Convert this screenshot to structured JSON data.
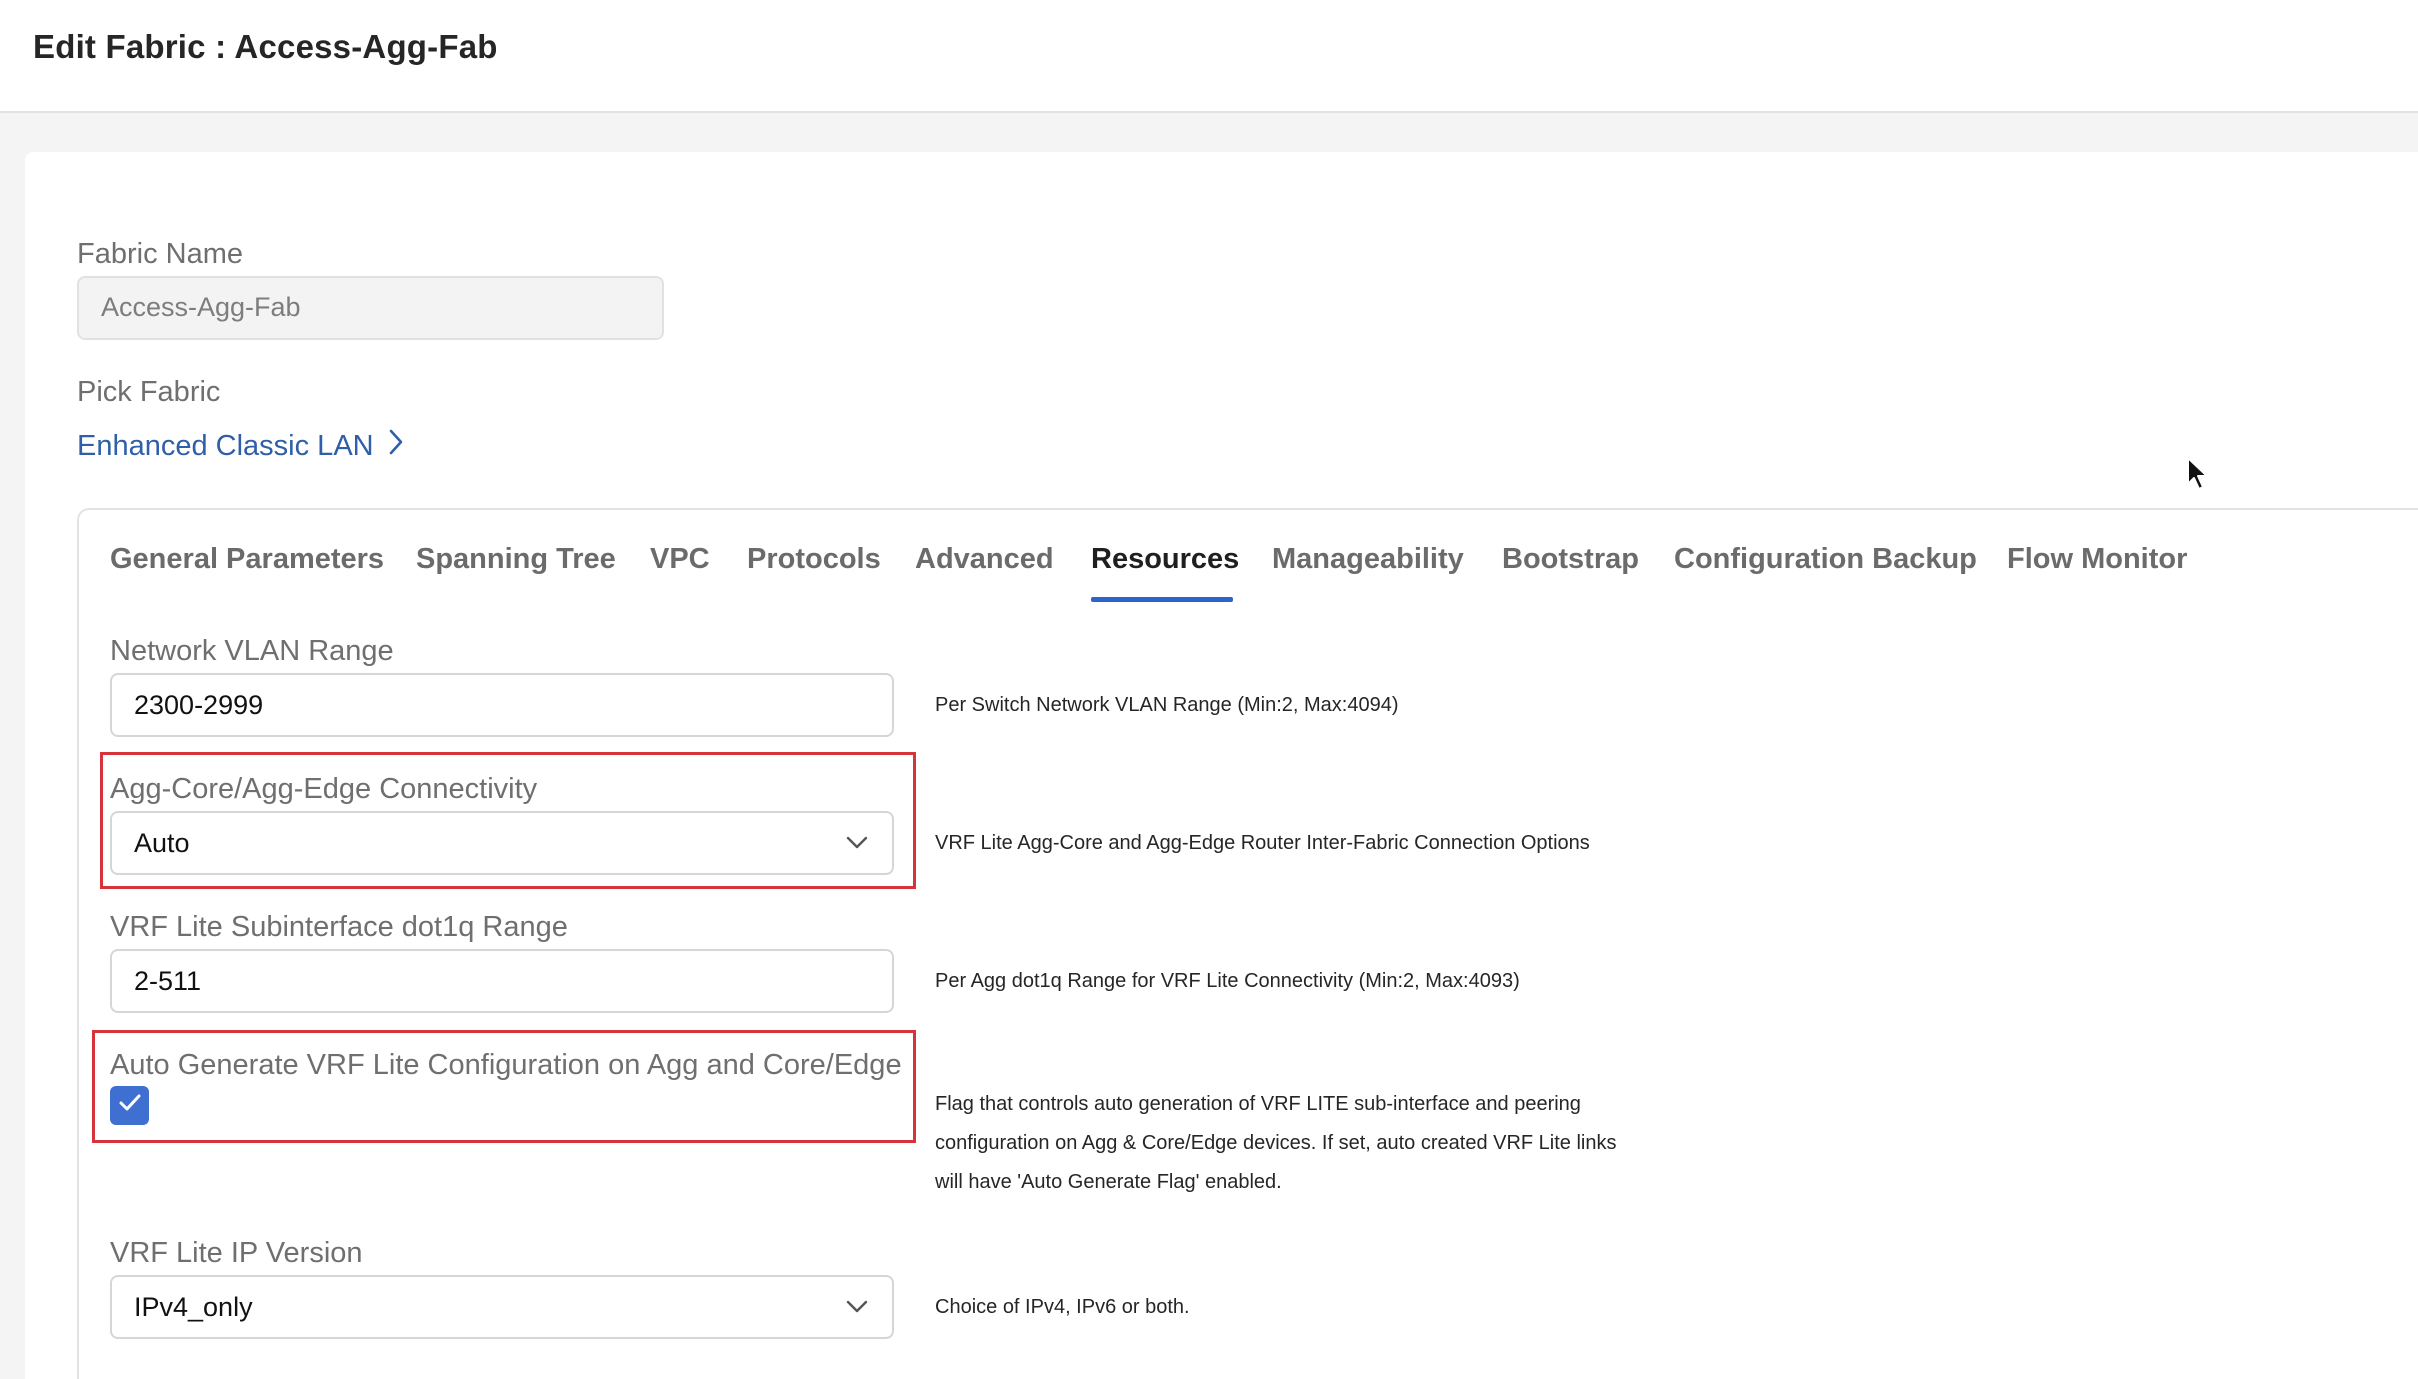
{
  "header": {
    "title": "Edit Fabric : Access-Agg-Fab"
  },
  "fabric_name": {
    "label": "Fabric Name",
    "value": "Access-Agg-Fab"
  },
  "pick_fabric": {
    "label": "Pick Fabric",
    "link": "Enhanced Classic LAN"
  },
  "tabs": [
    {
      "label": "General Parameters"
    },
    {
      "label": "Spanning Tree"
    },
    {
      "label": "VPC"
    },
    {
      "label": "Protocols"
    },
    {
      "label": "Advanced"
    },
    {
      "label": "Resources",
      "active": true
    },
    {
      "label": "Manageability"
    },
    {
      "label": "Bootstrap"
    },
    {
      "label": "Configuration Backup"
    },
    {
      "label": "Flow Monitor"
    }
  ],
  "fields": {
    "network_vlan": {
      "label": "Network VLAN Range",
      "value": "2300-2999",
      "help": "Per Switch Network VLAN Range (Min:2, Max:4094)"
    },
    "agg_connectivity": {
      "label": "Agg-Core/Agg-Edge Connectivity",
      "value": "Auto",
      "help": "VRF Lite Agg-Core and Agg-Edge Router Inter-Fabric Connection Options"
    },
    "dot1q_range": {
      "label": "VRF Lite Subinterface dot1q Range",
      "value": "2-511",
      "help": "Per Agg dot1q Range for VRF Lite Connectivity (Min:2, Max:4093)"
    },
    "auto_generate": {
      "label": "Auto Generate VRF Lite Configuration on Agg and Core/Edge",
      "checked": true,
      "help_lines": [
        "Flag that controls auto generation of VRF LITE sub-interface and peering",
        "configuration on Agg & Core/Edge devices. If set, auto created VRF Lite links",
        "will have 'Auto Generate Flag' enabled."
      ]
    },
    "ip_version": {
      "label": "VRF Lite IP Version",
      "value": "IPv4_only",
      "help": "Choice of IPv4, IPv6 or both."
    }
  },
  "colors": {
    "accent": "#2d64c8",
    "link": "#2f5fa8",
    "highlight_box": "#d7333a",
    "checkbox": "#3f6fd1"
  }
}
